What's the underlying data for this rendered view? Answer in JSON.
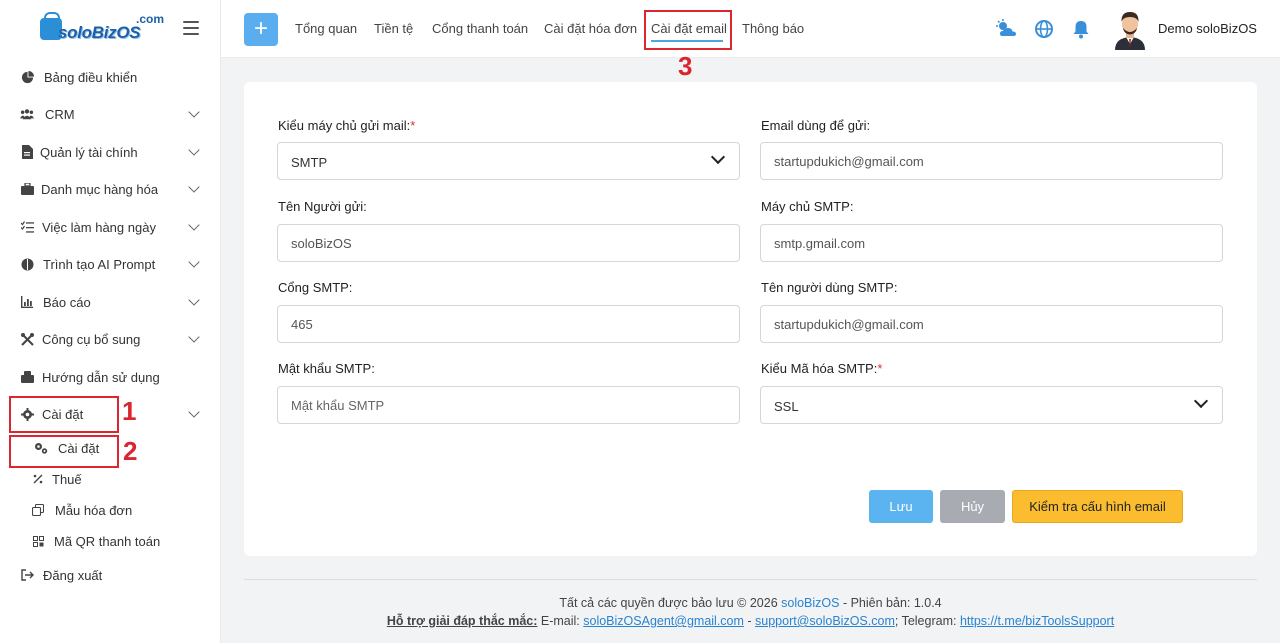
{
  "brand": {
    "logo_com": ".com",
    "logo_name": "soloBizOS"
  },
  "sidebar": {
    "items": [
      {
        "label": "Bảng điều khiển",
        "icon": "pie-chart-icon"
      },
      {
        "label": "CRM",
        "icon": "users-icon"
      },
      {
        "label": "Quản lý tài chính",
        "icon": "document-icon"
      },
      {
        "label": "Danh mục hàng hóa",
        "icon": "briefcase-icon"
      },
      {
        "label": "Việc làm hàng ngày",
        "icon": "checklist-icon"
      },
      {
        "label": "Trình tạo AI Prompt",
        "icon": "ai-icon"
      },
      {
        "label": "Báo cáo",
        "icon": "bar-chart-icon"
      },
      {
        "label": "Công cụ bổ sung",
        "icon": "tools-icon"
      },
      {
        "label": "Hướng dẫn sử dụng",
        "icon": "guide-icon"
      },
      {
        "label": "Cài đặt",
        "icon": "gear-icon"
      }
    ],
    "submenu": [
      {
        "label": "Cài đặt",
        "icon": "gears-icon"
      },
      {
        "label": "Thuế",
        "icon": "percent-icon"
      },
      {
        "label": "Mẫu hóa đơn",
        "icon": "copy-icon"
      },
      {
        "label": "Mã QR thanh toán",
        "icon": "qr-icon"
      }
    ],
    "logout": {
      "label": "Đăng xuất",
      "icon": "logout-icon"
    }
  },
  "topnav": {
    "tabs": [
      "Tổng quan",
      "Tiền tệ",
      "Cổng thanh toán",
      "Cài đặt hóa đơn",
      "Cài đặt email",
      "Thông báo"
    ],
    "active": "Cài đặt email",
    "user_name": "Demo soloBizOS"
  },
  "annotations": [
    "1",
    "2",
    "3"
  ],
  "form": {
    "server_type_label": "Kiểu máy chủ gửi mail:",
    "server_type_value": "SMTP",
    "sender_email_label": "Email dùng để gửi:",
    "sender_email_value": "startupdukich@gmail.com",
    "sender_name_label": "Tên Người gửi:",
    "sender_name_value": "soloBizOS",
    "smtp_host_label": "Máy chủ SMTP:",
    "smtp_host_value": "smtp.gmail.com",
    "smtp_port_label": "Cổng SMTP:",
    "smtp_port_value": "465",
    "smtp_user_label": "Tên người dùng SMTP:",
    "smtp_user_value": "startupdukich@gmail.com",
    "smtp_password_label": "Mật khẩu SMTP:",
    "smtp_password_placeholder": "Mật khẩu SMTP",
    "encryption_label": "Kiểu Mã hóa SMTP:",
    "encryption_value": "SSL",
    "required_mark": "*"
  },
  "buttons": {
    "save": "Lưu",
    "cancel": "Hủy",
    "test": "Kiểm tra cấu hình email"
  },
  "footer": {
    "rights_prefix": "Tất cả các quyền được bảo lưu © 2026 ",
    "brand_link": "soloBizOS",
    "version": " - Phiên bản: 1.0.4",
    "support_label": "Hỗ trợ giải đáp thắc mắc:",
    "email_prefix": " E-mail: ",
    "email1": "soloBizOSAgent@gmail.com",
    "sep": " - ",
    "email2": "support@soloBizOS.com",
    "telegram_prefix": "; Telegram: ",
    "telegram": "https://t.me/bizToolsSupport"
  }
}
